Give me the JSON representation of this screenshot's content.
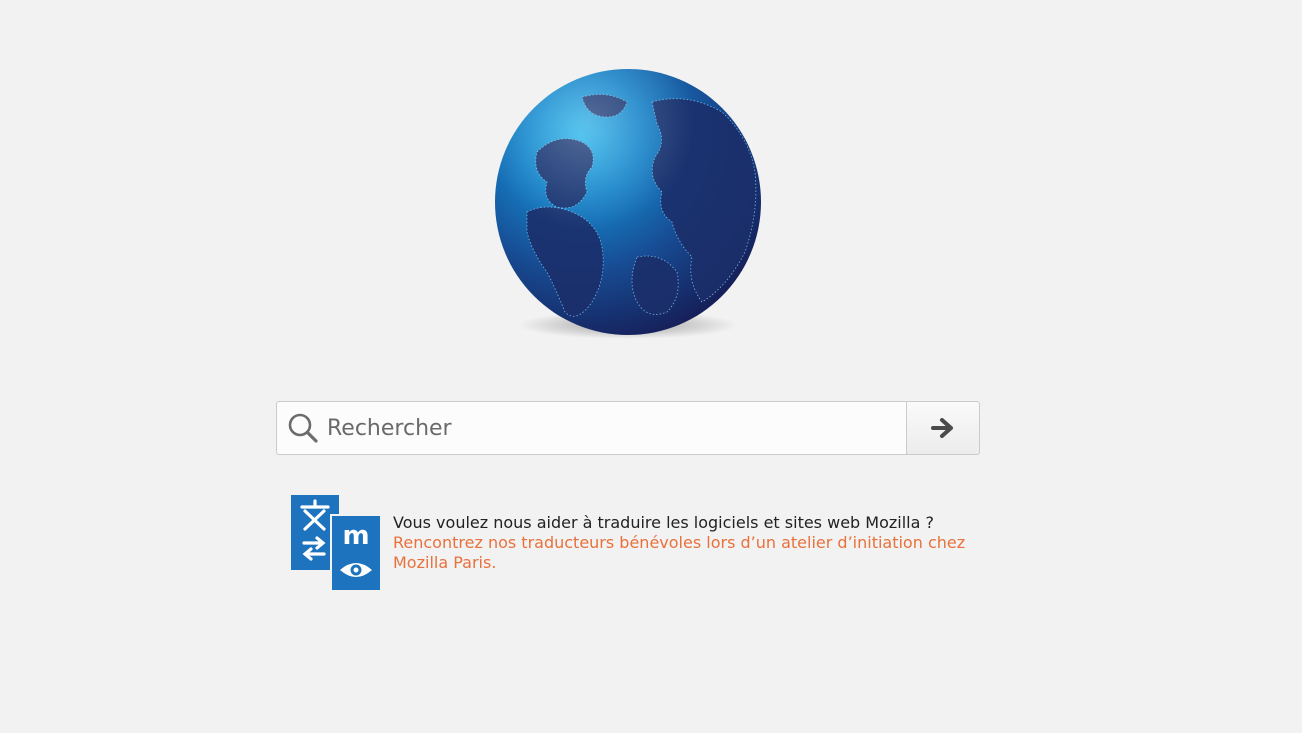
{
  "search": {
    "placeholder": "Rechercher",
    "value": "",
    "submit_icon": "arrow-right-icon"
  },
  "logo": {
    "icon": "globe-logo-icon"
  },
  "snippet": {
    "icon": "translation-icon",
    "text": "Vous voulez nous aider à traduire les logiciels et sites web Mozilla ?",
    "link_text": "Rencontrez nos traducteurs bénévoles lors d’un atelier d’initiation chez Mozilla Paris.",
    "link_color": "#e8713c"
  },
  "colors": {
    "background": "#f2f2f2",
    "snippet_icon_blue": "#1e73be"
  }
}
